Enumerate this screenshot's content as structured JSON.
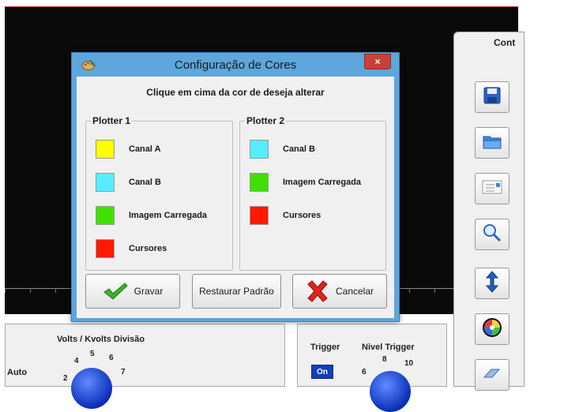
{
  "dialog": {
    "title": "Configuração de Cores",
    "close_label": "×",
    "instruction": "Clique em cima da cor de deseja alterar",
    "plotter1": {
      "label": "Plotter 1",
      "items": [
        {
          "label": "Canal A",
          "color": "#ffff00"
        },
        {
          "label": "Canal B",
          "color": "#55eeff"
        },
        {
          "label": "Imagem Carregada",
          "color": "#3fe000"
        },
        {
          "label": "Cursores",
          "color": "#ff1a00"
        }
      ]
    },
    "plotter2": {
      "label": "Plotter 2",
      "items": [
        {
          "label": "Canal B",
          "color": "#55eeff"
        },
        {
          "label": "Imagem Carregada",
          "color": "#3fe000"
        },
        {
          "label": "Cursores",
          "color": "#ff1a00"
        }
      ]
    },
    "buttons": {
      "save": "Gravar",
      "restore": "Restaurar Padrão",
      "cancel": "Cancelar"
    }
  },
  "right_panel": {
    "title": "Cont"
  },
  "bottom": {
    "volts_title": "Volts / Kvolts Divisão",
    "auto_label": "Auto",
    "volts_knob_numbers": [
      "2",
      "4",
      "5",
      "6",
      "7"
    ],
    "trigger_label": "Trigger",
    "trigger_button": "On",
    "nivel_trigger_label": "Nivel Trigger",
    "trigger_knob_numbers": [
      "6",
      "8",
      "10"
    ]
  },
  "icons": {
    "right_panel": [
      "save-disk-icon",
      "open-folder-icon",
      "document-icon",
      "magnifier-icon",
      "vertical-arrows-icon",
      "color-wheel-icon",
      "eraser-icon"
    ],
    "dialog": [
      "palette-icon",
      "checkmark-icon",
      "red-x-icon"
    ]
  },
  "colors": {
    "titlebar": "#5ea6dc",
    "close_button": "#c7413a",
    "scope_background": "#0a0a0a",
    "knob": "#0b2fb8"
  }
}
